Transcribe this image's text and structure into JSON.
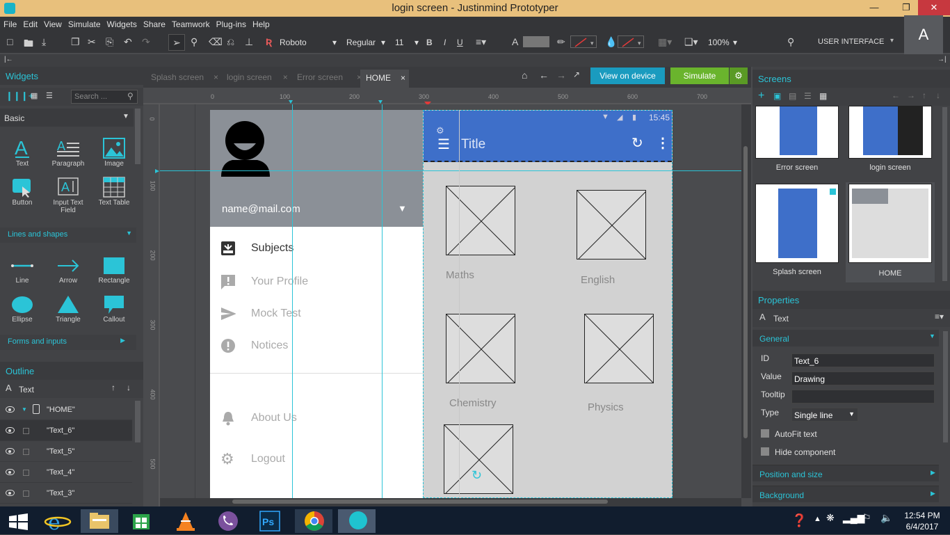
{
  "window": {
    "title": "login screen - Justinmind Prototyper",
    "minimize": "—",
    "maximize": "❐",
    "close": "✕"
  },
  "menu": [
    "File",
    "Edit",
    "View",
    "Simulate",
    "Widgets",
    "Share",
    "Teamwork",
    "Plug-ins",
    "Help"
  ],
  "toolbar": {
    "font": "Roboto",
    "weight": "Regular",
    "size": "11",
    "bold": "B",
    "italic": "I",
    "underline": "U",
    "zoom": "100%",
    "mode": "USER INTERFACE",
    "avatar": "A"
  },
  "widgets_panel": {
    "title": "Widgets",
    "search_placeholder": "Search ...",
    "category": "Basic",
    "basic": [
      "Text",
      "Paragraph",
      "Image",
      "Button",
      "Input Text Field",
      "Text Table"
    ],
    "lines_title": "Lines and shapes",
    "shapes": [
      "Line",
      "Arrow",
      "Rectangle",
      "Ellipse",
      "Triangle",
      "Callout"
    ],
    "forms_title": "Forms and inputs"
  },
  "outline": {
    "title": "Outline",
    "filter": "Text",
    "items": [
      "\"HOME\"",
      "\"Text_6\"",
      "\"Text_5\"",
      "\"Text_4\"",
      "\"Text_3\""
    ]
  },
  "tabs": [
    "Splash screen",
    "login screen",
    "Error screen",
    "HOME"
  ],
  "buttons": {
    "view_device": "View on device",
    "simulate": "Simulate"
  },
  "ruler": {
    "h": [
      "0",
      "100",
      "200",
      "300",
      "400",
      "500",
      "600",
      "700"
    ],
    "v": [
      "0",
      "100",
      "200",
      "300",
      "400",
      "500"
    ]
  },
  "drawer": {
    "email": "name@mail.com",
    "items": [
      "Subjects",
      "Your Profile",
      "Mock Test",
      "Notices"
    ],
    "items2": [
      "About Us",
      "Logout"
    ]
  },
  "phone": {
    "time": "15:45",
    "title": "Title",
    "subjects": [
      "Maths",
      "English",
      "Chemistry",
      "Physics"
    ]
  },
  "screens_panel": {
    "title": "Screens",
    "screens": [
      "Error screen",
      "login screen",
      "Splash screen",
      "HOME"
    ]
  },
  "properties": {
    "title": "Properties",
    "type_label": "Text",
    "general": "General",
    "id_label": "ID",
    "id_value": "Text_6",
    "value_label": "Value",
    "value_value": "Drawing",
    "tooltip_label": "Tooltip",
    "tooltip_value": "",
    "type_field_label": "Type",
    "type_value": "Single line",
    "autofit": "AutoFit text",
    "hide": "Hide component",
    "position": "Position and size",
    "background": "Background"
  },
  "taskbar": {
    "time": "12:54 PM",
    "date": "6/4/2017"
  },
  "colors": {
    "accent": "#2bc4d7",
    "simulate": "#6ab42d",
    "device": "#1a9bbf",
    "phone_header": "#3e6fc9"
  }
}
